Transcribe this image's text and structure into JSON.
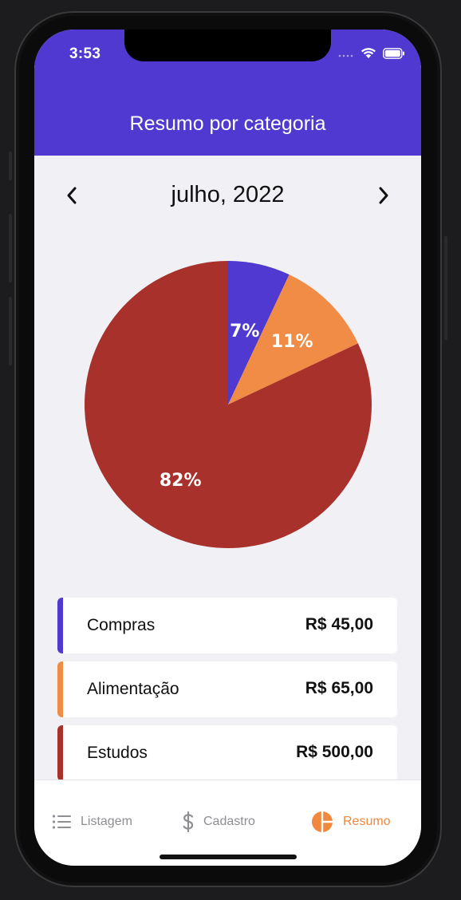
{
  "status_bar": {
    "time": "3:53"
  },
  "header": {
    "title": "Resumo por categoria"
  },
  "month_nav": {
    "label": "julho, 2022"
  },
  "chart_data": {
    "type": "pie",
    "slices": [
      {
        "label": "Compras",
        "percent": 7,
        "label_text": "7%",
        "color": "#5039d0"
      },
      {
        "label": "Alimentação",
        "percent": 11,
        "label_text": "11%",
        "color": "#f08c45"
      },
      {
        "label": "Estudos",
        "percent": 82,
        "label_text": "82%",
        "color": "#a8312c"
      }
    ]
  },
  "categories": [
    {
      "name": "Compras",
      "value": "R$ 45,00",
      "color": "#5039d0"
    },
    {
      "name": "Alimentação",
      "value": "R$ 65,00",
      "color": "#f08c45"
    },
    {
      "name": "Estudos",
      "value": "R$ 500,00",
      "color": "#a8312c"
    }
  ],
  "tabs": [
    {
      "label": "Listagem",
      "icon": "list-icon",
      "active": false
    },
    {
      "label": "Cadastro",
      "icon": "dollar-icon",
      "active": false
    },
    {
      "label": "Resumo",
      "icon": "pie-chart-icon",
      "active": true
    }
  ],
  "colors": {
    "header": "#5039d0",
    "active_tab": "#f0883d"
  }
}
